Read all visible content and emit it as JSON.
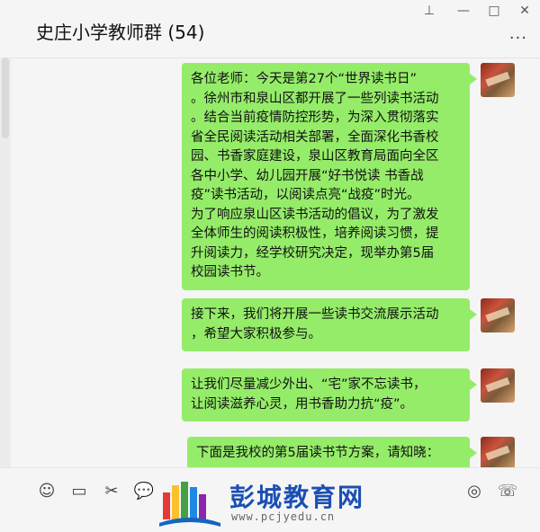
{
  "header": {
    "title": "史庄小学教师群 (54)",
    "pin_icon": "pin-icon",
    "min_icon": "minimize-icon",
    "max_icon": "maximize-icon",
    "close_icon": "close-icon",
    "more_icon": "more-icon"
  },
  "messages": [
    {
      "text": "各位老师：今天是第27个“世界读书日”\n。徐州市和泉山区都开展了一些列读书活动\n。结合当前疫情防控形势，为深入贯彻落实\n省全民阅读活动相关部署，全面深化书香校\n园、书香家庭建设，泉山区教育局面向全区\n各中小学、幼儿园开展“好书悦读 书香战\n疫”读书活动，以阅读点亮“战疫”时光。\n为了响应泉山区读书活动的倡议，为了激发\n全体师生的阅读积极性，培养阅读习惯，提\n升阅读力，经学校研究决定，现举办第5届\n校园读书节。"
    },
    {
      "text": "接下来，我们将开展一些读书交流展示活动\n，希望大家积极参与。"
    },
    {
      "text": "让我们尽量减少外出、“宅”家不忘读书，\n让阅读滋养心灵，用书香助力抗“疫”。"
    },
    {
      "text": "下面是我校的第5届读书节方案，请知晓："
    }
  ],
  "toolbar": {
    "emoji_icon": "emoji-icon",
    "folder_icon": "folder-icon",
    "scissors_icon": "scissors-icon",
    "chat_icon": "chat-history-icon",
    "live_icon": "live-icon",
    "call_icon": "voice-call-icon"
  },
  "watermark": {
    "name": "彭城教育网",
    "url": "www.pcjyedu.cn"
  }
}
